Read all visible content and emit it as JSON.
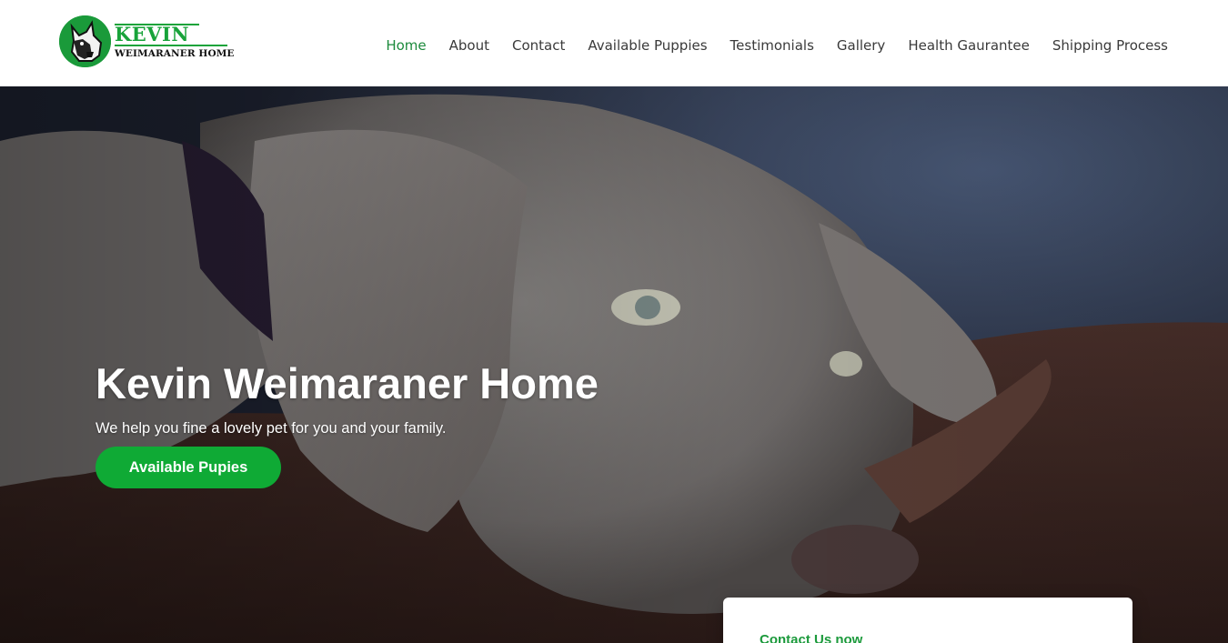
{
  "brand": {
    "name": "KEVIN",
    "tagline": "WEIMARANER HOME",
    "accent_color": "#18a33a"
  },
  "nav": {
    "items": [
      {
        "label": "Home",
        "active": true
      },
      {
        "label": "About"
      },
      {
        "label": "Contact"
      },
      {
        "label": "Available Puppies"
      },
      {
        "label": "Testimonials"
      },
      {
        "label": "Gallery"
      },
      {
        "label": "Health Gaurantee"
      },
      {
        "label": "Shipping Process"
      }
    ]
  },
  "hero": {
    "title": "Kevin Weimaraner Home",
    "subtitle": "We help you fine a lovely pet for you and your family.",
    "cta_label": "Available Pupies",
    "cta_color": "#0faa35",
    "background_icon": "weimaraner-puppy-photo"
  },
  "contact_card": {
    "title": "Contact Us now"
  }
}
